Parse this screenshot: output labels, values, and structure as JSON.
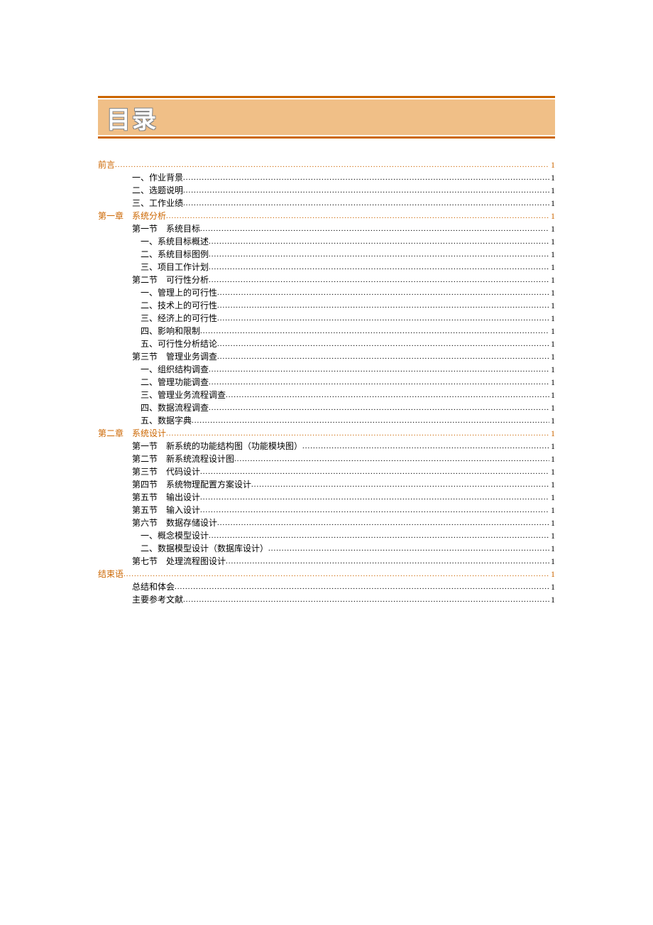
{
  "title": "目录",
  "entries": [
    {
      "level": 0,
      "label": "前言",
      "page": "1"
    },
    {
      "level": 1,
      "label": "一、作业背景",
      "page": "1"
    },
    {
      "level": 1,
      "label": "二、选题说明",
      "page": "1"
    },
    {
      "level": 1,
      "label": "三、工作业绩",
      "page": "1"
    },
    {
      "level": 0,
      "label": "第一章　系统分析",
      "page": "1"
    },
    {
      "level": 1,
      "label": "第一节　系统目标",
      "page": "1"
    },
    {
      "level": 2,
      "label": "一、系统目标概述",
      "page": "1"
    },
    {
      "level": 2,
      "label": "二、系统目标图例",
      "page": "1"
    },
    {
      "level": 2,
      "label": "三、项目工作计划",
      "page": "1"
    },
    {
      "level": 1,
      "label": "第二节　可行性分析",
      "page": "1"
    },
    {
      "level": 2,
      "label": "一、管理上的可行性",
      "page": "1"
    },
    {
      "level": 2,
      "label": "二、技术上的可行性",
      "page": "1"
    },
    {
      "level": 2,
      "label": "三、经济上的可行性",
      "page": "1"
    },
    {
      "level": 2,
      "label": "四、影响和限制",
      "page": "1"
    },
    {
      "level": 2,
      "label": "五、可行性分析结论",
      "page": "1"
    },
    {
      "level": 1,
      "label": "第三节　管理业务调查",
      "page": "1"
    },
    {
      "level": 2,
      "label": "一、组织结构调查",
      "page": "1"
    },
    {
      "level": 2,
      "label": "二、管理功能调查",
      "page": "1"
    },
    {
      "level": 2,
      "label": "三、管理业务流程调查",
      "page": "1"
    },
    {
      "level": 2,
      "label": "四、数据流程调查",
      "page": "1"
    },
    {
      "level": 2,
      "label": "五、数据字典",
      "page": "1"
    },
    {
      "level": 0,
      "label": "第二章　系统设计",
      "page": "1"
    },
    {
      "level": 1,
      "label": "第一节　新系统的功能结构图（功能模块图）",
      "page": "1"
    },
    {
      "level": 1,
      "label": "第二节　新系统流程设计图",
      "page": "1"
    },
    {
      "level": 1,
      "label": "第三节　代码设计",
      "page": "1"
    },
    {
      "level": 1,
      "label": "第四节　系统物理配置方案设计",
      "page": "1"
    },
    {
      "level": 1,
      "label": "第五节　输出设计",
      "page": "1"
    },
    {
      "level": 1,
      "label": "第五节　输入设计",
      "page": "1"
    },
    {
      "level": 1,
      "label": "第六节　数据存储设计",
      "page": "1"
    },
    {
      "level": 2,
      "label": "一、概念模型设计",
      "page": "1"
    },
    {
      "level": 2,
      "label": "二、数据模型设计（数据库设计）",
      "page": "1"
    },
    {
      "level": 1,
      "label": "第七节　处理流程图设计",
      "page": "1"
    },
    {
      "level": 0,
      "label": "结束语",
      "page": "1"
    },
    {
      "level": 1,
      "label": "总结和体会",
      "page": "1"
    },
    {
      "level": 1,
      "label": "主要参考文献",
      "page": "1"
    }
  ]
}
